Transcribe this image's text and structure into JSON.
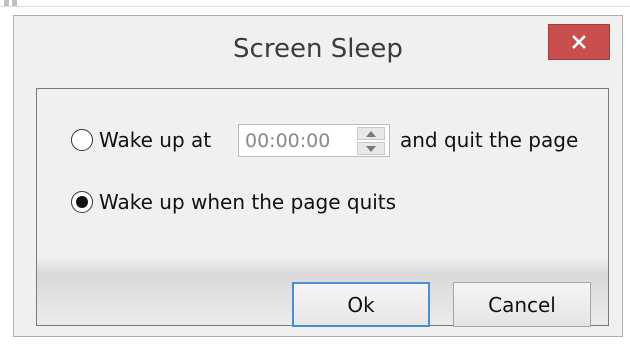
{
  "dialog": {
    "title": "Screen Sleep",
    "close_icon": "close-icon",
    "close_button_color": "#c94f4f"
  },
  "options": {
    "wake_at": {
      "label": "Wake up at",
      "selected": false,
      "time_value": "00:00:00",
      "after_label": "and quit the page"
    },
    "wake_on_quit": {
      "label": "Wake up when the page quits",
      "selected": true
    }
  },
  "buttons": {
    "ok_label": "Ok",
    "cancel_label": "Cancel",
    "focus_color": "#4a8fd6"
  }
}
